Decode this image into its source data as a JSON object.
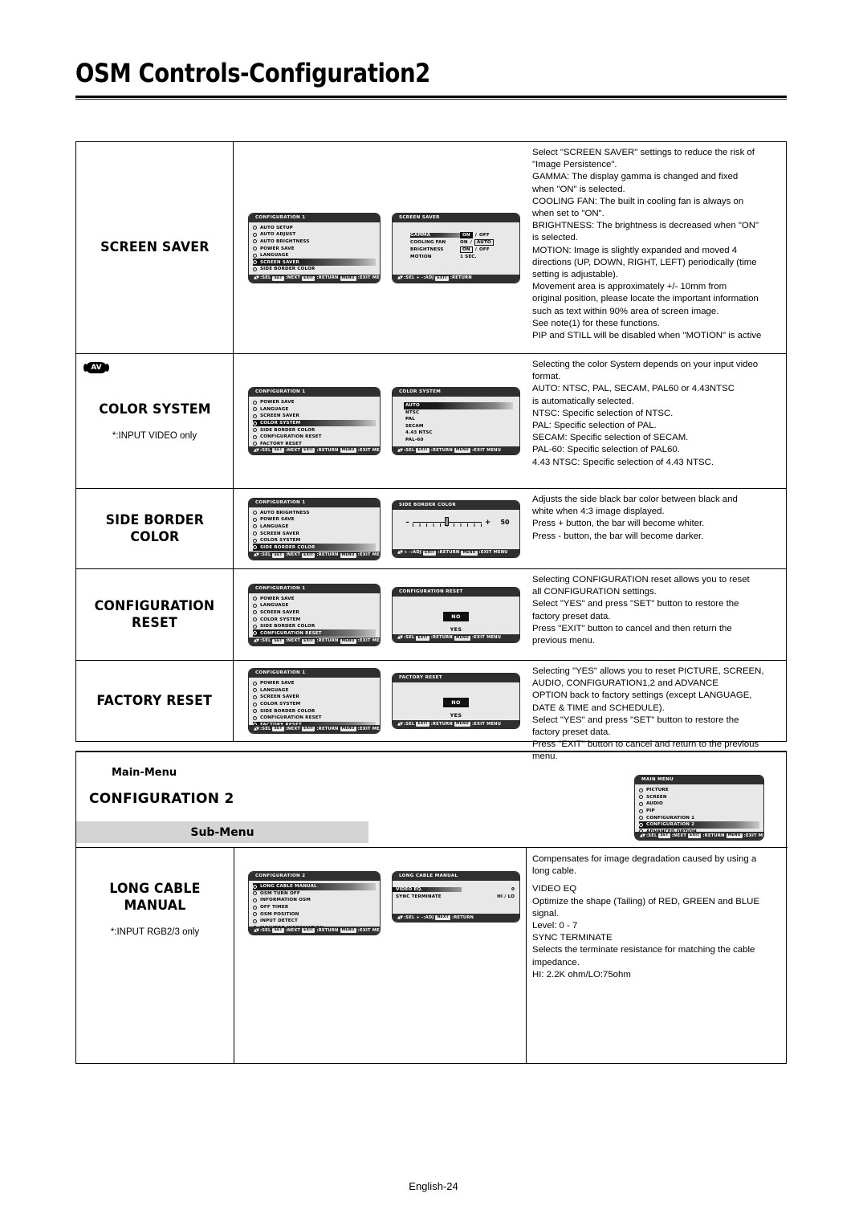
{
  "page": {
    "title": "OSM Controls-Configuration2",
    "footer": "English-24"
  },
  "rows": [
    {
      "label": "SCREEN SAVER",
      "note": "",
      "badge": "",
      "menus": [
        {
          "kind": "list",
          "title": "CONFIGURATION 1",
          "items": [
            {
              "text": "AUTO SETUP",
              "highlighted": false
            },
            {
              "text": "AUTO ADJUST",
              "highlighted": false
            },
            {
              "text": "AUTO BRIGHTNESS",
              "highlighted": false
            },
            {
              "text": "POWER SAVE",
              "highlighted": false
            },
            {
              "text": "LANGUAGE",
              "highlighted": false
            },
            {
              "text": "SCREEN SAVER",
              "highlighted": true
            },
            {
              "text": "SIDE BORDER COLOR",
              "highlighted": false
            }
          ],
          "footer": ":SEL|SET|:NEXT|EXIT|:RETURN|MENU|:EXIT MENU"
        },
        {
          "kind": "screensaver",
          "title": "SCREEN SAVER",
          "settings": [
            {
              "name": "GAMMA",
              "name_hl": true,
              "values": [
                {
                  "t": "ON",
                  "style": "inv"
                },
                {
                  "t": "/",
                  "style": "plain"
                },
                {
                  "t": "OFF",
                  "style": "plain"
                }
              ]
            },
            {
              "name": "COOLING FAN",
              "name_hl": false,
              "values": [
                {
                  "t": "ON",
                  "style": "plain"
                },
                {
                  "t": "/",
                  "style": "plain"
                },
                {
                  "t": "AUTO",
                  "style": "box"
                }
              ]
            },
            {
              "name": "BRIGHTNESS",
              "name_hl": false,
              "values": [
                {
                  "t": "ON",
                  "style": "box"
                },
                {
                  "t": "/",
                  "style": "plain"
                },
                {
                  "t": "OFF",
                  "style": "plain"
                }
              ]
            },
            {
              "name": "MOTION",
              "name_hl": false,
              "values": [
                {
                  "t": "1  SEC.",
                  "style": "plain"
                }
              ]
            }
          ],
          "footer": ":SEL  + -:ADJ|EXIT|:RETURN"
        }
      ],
      "desc": [
        "Select \"SCREEN SAVER\" settings to reduce the risk of",
        "\"Image Persistence\".",
        "GAMMA: The display gamma is changed and fixed",
        "when \"ON\" is selected.",
        "COOLING FAN: The built in cooling fan is always on",
        "when set to \"ON\".",
        "BRIGHTNESS: The brightness is decreased when \"ON\"",
        "is selected.",
        "MOTION: Image is slightly expanded and moved 4",
        "directions (UP, DOWN, RIGHT, LEFT) periodically (time",
        "setting is adjustable).",
        "Movement area is approximately +/- 10mm from",
        "original position, please locate the important information",
        "such as text within 90% area of screen image.",
        "See note(1) for these functions.",
        "PIP and STILL will be disabled when \"MOTION\" is active"
      ]
    },
    {
      "label": "COLOR SYSTEM",
      "note": "*:INPUT VIDEO only",
      "badge": "AV",
      "menus": [
        {
          "kind": "list",
          "title": "CONFIGURATION 1",
          "items": [
            {
              "text": "POWER SAVE",
              "highlighted": false
            },
            {
              "text": "LANGUAGE",
              "highlighted": false
            },
            {
              "text": "SCREEN SAVER",
              "highlighted": false
            },
            {
              "text": "COLOR SYSTEM",
              "highlighted": true
            },
            {
              "text": "SIDE BORDER COLOR",
              "highlighted": false
            },
            {
              "text": "CONFIGURATION RESET",
              "highlighted": false
            },
            {
              "text": "FACTORY RESET",
              "highlighted": false
            }
          ],
          "footer": ":SEL|SET|:NEXT|EXIT|:RETURN|MENU|:EXIT MENU"
        },
        {
          "kind": "plainlist",
          "title": "COLOR SYSTEM",
          "items": [
            {
              "text": "AUTO",
              "highlighted": true
            },
            {
              "text": "NTSC",
              "highlighted": false
            },
            {
              "text": "PAL",
              "highlighted": false
            },
            {
              "text": "SECAM",
              "highlighted": false
            },
            {
              "text": "4.43 NTSC",
              "highlighted": false
            },
            {
              "text": "PAL-60",
              "highlighted": false
            }
          ],
          "footer": ":SEL|EXIT|:RETURN|MENU|:EXIT MENU"
        }
      ],
      "desc": [
        "Selecting the color System depends on your input video",
        "format.",
        "AUTO: NTSC, PAL, SECAM, PAL60 or 4.43NTSC",
        "is automatically selected.",
        "NTSC: Specific selection of NTSC.",
        "PAL:  Specific selection of PAL.",
        "SECAM: Specific selection of SECAM.",
        "PAL-60: Specific selection of PAL60.",
        "4.43 NTSC: Specific selection of 4.43 NTSC."
      ]
    },
    {
      "label": "SIDE BORDER\nCOLOR",
      "note": "",
      "badge": "",
      "menus": [
        {
          "kind": "list",
          "title": "CONFIGURATION 1",
          "items": [
            {
              "text": "AUTO BRIGHTNESS",
              "highlighted": false
            },
            {
              "text": "POWER SAVE",
              "highlighted": false
            },
            {
              "text": "LANGUAGE",
              "highlighted": false
            },
            {
              "text": "SCREEN SAVER",
              "highlighted": false
            },
            {
              "text": "COLOR SYSTEM",
              "highlighted": false
            },
            {
              "text": "SIDE BORDER COLOR",
              "highlighted": true
            },
            {
              "text": "CONFIGURATION RESET",
              "highlighted": false
            },
            {
              "text": "FACTORY RESET",
              "highlighted": false
            }
          ],
          "footer": ":SEL|SET|:NEXT|EXIT|:RETURN|MENU|:EXIT MENU"
        },
        {
          "kind": "slider",
          "title": "SIDE BORDER COLOR",
          "minus": "–",
          "plus": "+",
          "value": "50",
          "footer": "+ -:ADJ|EXIT|:RETURN|MENU|:EXIT MENU"
        }
      ],
      "desc": [
        "Adjusts the side black bar color between black and",
        "white when 4:3 image displayed.",
        "Press + button, the bar will become whiter.",
        "Press - button, the bar will become darker."
      ]
    },
    {
      "label": "CONFIGURATION\nRESET",
      "note": "",
      "badge": "",
      "menus": [
        {
          "kind": "list",
          "title": "CONFIGURATION 1",
          "items": [
            {
              "text": "POWER SAVE",
              "highlighted": false
            },
            {
              "text": "LANGUAGE",
              "highlighted": false
            },
            {
              "text": "SCREEN SAVER",
              "highlighted": false
            },
            {
              "text": "COLOR SYSTEM",
              "highlighted": false
            },
            {
              "text": "SIDE BORDER COLOR",
              "highlighted": false
            },
            {
              "text": "CONFIGURATION RESET",
              "highlighted": true
            },
            {
              "text": "FACTORY RESET",
              "highlighted": false
            }
          ],
          "footer": ":SEL|SET|:NEXT|EXIT|:RETURN|MENU|:EXIT MENU"
        },
        {
          "kind": "yesno",
          "title": "CONFIGURATION RESET",
          "no": "NO",
          "yes": "YES",
          "footer": ":SEL|EXIT|:RETURN|MENU|:EXIT MENU"
        }
      ],
      "desc": [
        "Selecting CONFIGURATION reset allows you to reset",
        "all CONFIGURATION settings.",
        "Select \"YES\" and press \"SET\" button to restore the",
        "factory preset data.",
        "Press \"EXIT\" button to cancel and then return the",
        "previous menu."
      ]
    },
    {
      "label": "FACTORY RESET",
      "note": "",
      "badge": "",
      "menus": [
        {
          "kind": "list",
          "title": "CONFIGURATION 1",
          "items": [
            {
              "text": "POWER SAVE",
              "highlighted": false
            },
            {
              "text": "LANGUAGE",
              "highlighted": false
            },
            {
              "text": "SCREEN SAVER",
              "highlighted": false
            },
            {
              "text": "COLOR SYSTEM",
              "highlighted": false
            },
            {
              "text": "SIDE BORDER COLOR",
              "highlighted": false
            },
            {
              "text": "CONFIGURATION RESET",
              "highlighted": false
            },
            {
              "text": "FACTORY RESET",
              "highlighted": true
            }
          ],
          "footer": ":SEL|SET|:NEXT|EXIT|:RETURN|MENU|:EXIT MENU"
        },
        {
          "kind": "yesno",
          "title": "FACTORY RESET",
          "no": "NO",
          "yes": "YES",
          "footer": ":SEL|EXIT|:RETURN|MENU|:EXIT MENU"
        }
      ],
      "desc": [
        "Selecting \"YES\" allows you to reset PICTURE, SCREEN,",
        "AUDIO, CONFIGURATION1,2 and ADVANCE",
        "OPTION back to factory settings (except LANGUAGE,",
        "DATE & TIME and SCHEDULE).",
        "Select \"YES\" and press \"SET\" button to restore the",
        "factory preset data.",
        "Press \"EXIT\" button to cancel and return to the previous",
        "menu."
      ]
    }
  ],
  "band": {
    "main_menu_label": "Main-Menu",
    "main_menu_title": "CONFIGURATION 2",
    "sub_menu_label": "Sub-Menu",
    "main_menu_osm": {
      "kind": "list",
      "title": "MAIN MENU",
      "items": [
        {
          "text": "PICTURE",
          "highlighted": false
        },
        {
          "text": "SCREEN",
          "highlighted": false
        },
        {
          "text": "AUDIO",
          "highlighted": false
        },
        {
          "text": "PIP",
          "highlighted": false
        },
        {
          "text": "CONFIGURATION 1",
          "highlighted": false
        },
        {
          "text": "CONFIGURATION 2",
          "highlighted": true
        },
        {
          "text": "ADVANCED OPTION",
          "highlighted": false
        }
      ],
      "footer": ":SEL|SET|:NEXT|EXIT|:RETURN|MENU|:EXIT MENU"
    },
    "long_cable": {
      "label": "LONG CABLE\nMANUAL",
      "note": "*:INPUT RGB2/3 only",
      "menus": [
        {
          "kind": "list",
          "title": "CONFIGURATION 2",
          "items": [
            {
              "text": "LONG CABLE MANUAL",
              "highlighted": true
            },
            {
              "text": "OSM TURN OFF",
              "highlighted": false
            },
            {
              "text": "INFORMATION OSM",
              "highlighted": false
            },
            {
              "text": "OFF TIMER",
              "highlighted": false
            },
            {
              "text": "OSM POSITION",
              "highlighted": false
            },
            {
              "text": "INPUT DETECT",
              "highlighted": false
            },
            {
              "text": "MONITOR INFORMATION",
              "highlighted": false
            }
          ],
          "footer": ":SEL|SET|:NEXT|EXIT|:RETURN|MENU|:EXIT MENU"
        },
        {
          "kind": "longcable",
          "title": "LONG CABLE MANUAL",
          "settings": [
            {
              "name": "VIDEO EQ.",
              "name_hl": true,
              "value": "0"
            },
            {
              "name": "SYNC TERMINATE",
              "name_hl": false,
              "value": "HI / LO"
            }
          ],
          "footer": ":SEL  + -:ADJ|NEXT|:RETURN"
        }
      ],
      "desc_intro": [
        "Compensates for image degradation caused by using a",
        "long cable."
      ],
      "desc_body": [
        "VIDEO EQ",
        "Optimize the shape (Tailing) of RED, GREEN and BLUE",
        "signal.",
        "Level: 0 - 7",
        "SYNC TERMINATE",
        "Selects the terminate resistance for matching the cable",
        "impedance.",
        "HI: 2.2K ohm/LO:75ohm"
      ]
    }
  }
}
